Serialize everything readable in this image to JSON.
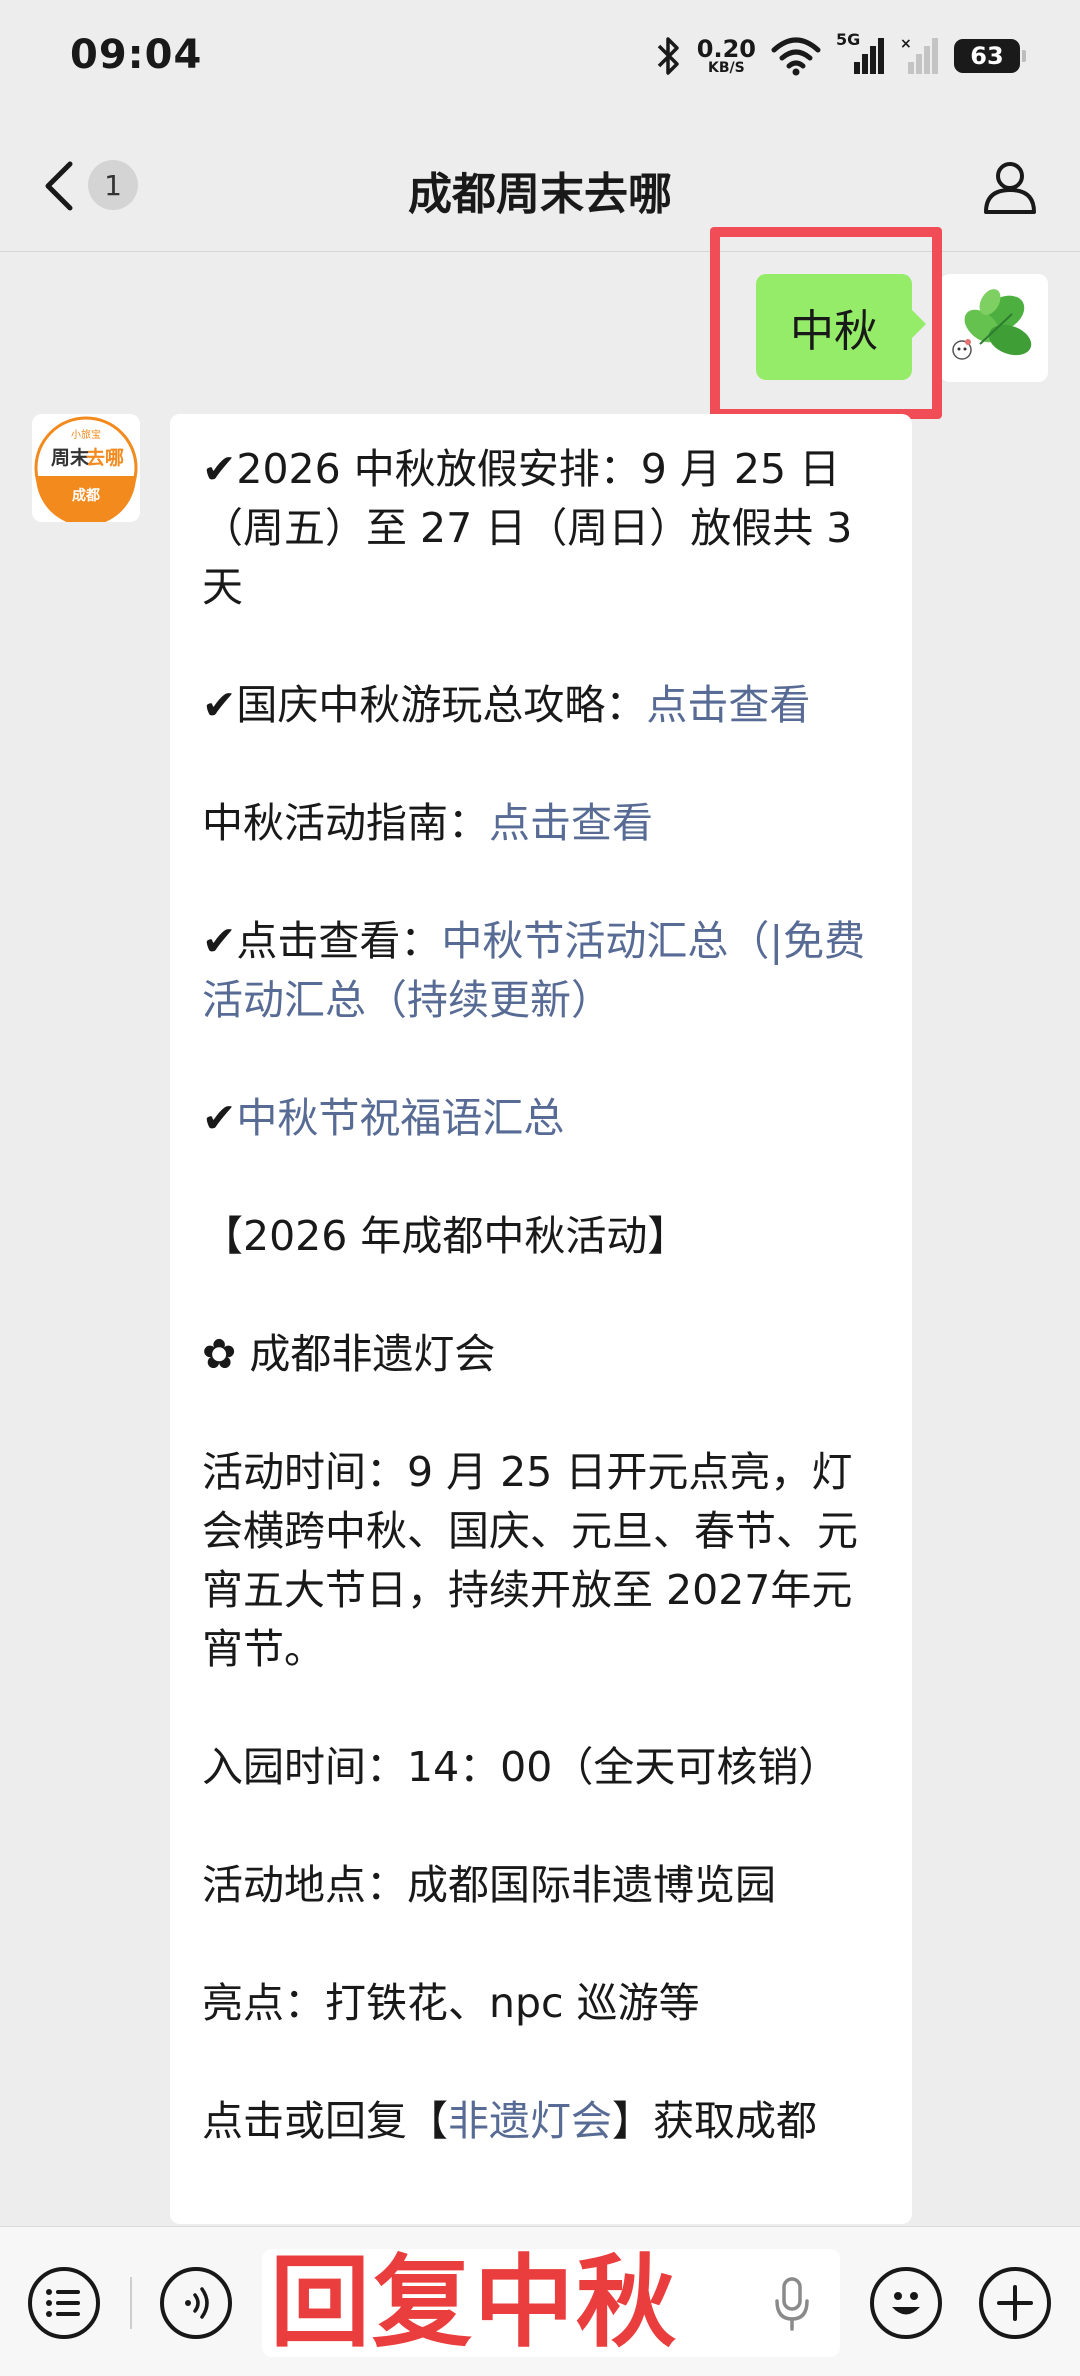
{
  "status_bar": {
    "time": "09:04",
    "net_speed_value": "0.20",
    "net_speed_unit": "KB/S",
    "signal_label": "5G",
    "battery": "63"
  },
  "nav": {
    "unread_count": "1",
    "title": "成都周末去哪"
  },
  "chat": {
    "my_message": "中秋",
    "bot_avatar_text": {
      "top": "小旅宝",
      "middle_a": "周末",
      "middle_b": "去哪",
      "bottom": "成都"
    },
    "bot_message": {
      "p1": "✔2026 中秋放假安排：9 月 25 日（周五）至 27 日（周日）放假共 3 天",
      "p2_prefix": "✔国庆中秋游玩总攻略：",
      "p2_link": "点击查看",
      "p3_prefix": "中秋活动指南：",
      "p3_link": "点击查看",
      "p4_prefix": "✔点击查看：",
      "p4_link": "中秋节活动汇总（|免费活动汇总（持续更新）",
      "p5_prefix": "✔",
      "p5_link": "中秋节祝福语汇总",
      "p6": "【2026 年成都中秋活动】",
      "p7": "✿ 成都非遗灯会",
      "p8": "活动时间：9 月 25 日开元点亮，灯会横跨中秋、国庆、元旦、春节、元宵五大节日，持续开放至 2027年元宵节。",
      "p9": "入园时间：14：00（全天可核销）",
      "p10": "活动地点：成都国际非遗博览园",
      "p11": "亮点：打铁花、npc 巡游等",
      "p12_prefix": "点击或回复【",
      "p12_link": "非遗灯会",
      "p12_suffix": "】获取成都"
    }
  },
  "input_bar": {
    "overlay_text": "回复中秋"
  },
  "colors": {
    "my_bubble": "#95ec69",
    "link": "#576b95",
    "highlight": "#f14d57",
    "overlay_text": "#ea3d3d"
  }
}
